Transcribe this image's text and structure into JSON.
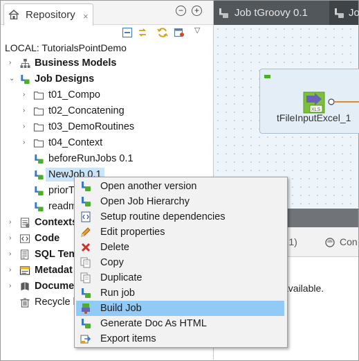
{
  "repository_panel": {
    "tab_title": "Repository",
    "close_glyph": "×",
    "minimize_glyph": "−",
    "maximize_glyph": "+",
    "view_menu_glyph": "▽",
    "project_label": "LOCAL: TutorialsPointDemo",
    "tree": [
      {
        "label": "Business Models",
        "bold": true,
        "arrow": "›",
        "icon": "business-models-icon"
      },
      {
        "label": "Job Designs",
        "bold": true,
        "arrow": "⌄",
        "icon": "job-designs-icon"
      },
      {
        "label": "t01_Compo",
        "arrow": "›",
        "icon": "folder-icon"
      },
      {
        "label": "t02_Concatening",
        "arrow": "›",
        "icon": "folder-icon"
      },
      {
        "label": "t03_DemoRoutines",
        "arrow": "›",
        "icon": "folder-icon"
      },
      {
        "label": "t04_Context",
        "arrow": "›",
        "icon": "folder-icon"
      },
      {
        "label": "beforeRunJobs 0.1",
        "icon": "job-icon"
      },
      {
        "label": "NewJob 0.1",
        "icon": "job-icon",
        "selected": true
      },
      {
        "label": "priorT",
        "icon": "job-icon"
      },
      {
        "label": "readm",
        "icon": "job-icon"
      },
      {
        "label": "Contexts",
        "bold": true,
        "arrow": "›",
        "icon": "contexts-icon"
      },
      {
        "label": "Code",
        "bold": true,
        "arrow": "›",
        "icon": "code-icon"
      },
      {
        "label": "SQL Tem",
        "bold": true,
        "arrow": "›",
        "icon": "sql-templates-icon"
      },
      {
        "label": "Metadat",
        "bold": true,
        "arrow": "›",
        "icon": "metadata-icon"
      },
      {
        "label": "Docume",
        "bold": true,
        "arrow": "›",
        "icon": "documentation-icon"
      },
      {
        "label": "Recycle b",
        "bold": false,
        "icon": "recycle-bin-icon"
      }
    ]
  },
  "editor": {
    "tabs": [
      "Job tGroovy 0.1",
      "Jo"
    ],
    "component_label": "tFileInputExcel_1",
    "component_badge": "XLS",
    "lower_tabs": [
      "b 0.1)",
      "Con"
    ],
    "lower_text": "available."
  },
  "context_menu": {
    "items": [
      {
        "label": "Open another version",
        "icon": "job-version-icon"
      },
      {
        "label": "Open Job Hierarchy",
        "icon": "job-hierarchy-icon"
      },
      {
        "label": "Setup routine dependencies",
        "icon": "routine-dependencies-icon"
      },
      {
        "label": "Edit properties",
        "icon": "edit-pencil-icon"
      },
      {
        "label": "Delete",
        "icon": "delete-x-icon"
      },
      {
        "label": "Copy",
        "icon": "copy-icon"
      },
      {
        "label": "Duplicate",
        "icon": "duplicate-icon"
      },
      {
        "label": "Run job",
        "icon": "run-job-icon"
      },
      {
        "label": "Build Job",
        "icon": "build-job-icon",
        "highlighted": true
      },
      {
        "label": "Generate Doc As HTML",
        "icon": "generate-doc-icon"
      },
      {
        "label": "Export items",
        "icon": "export-items-icon"
      }
    ]
  },
  "colors": {
    "menu_highlight": "#91c9f7",
    "tree_selection": "#cce4f7",
    "editor_tab_bar": "#3e4347",
    "canvas_bg": "#edf4fa"
  }
}
